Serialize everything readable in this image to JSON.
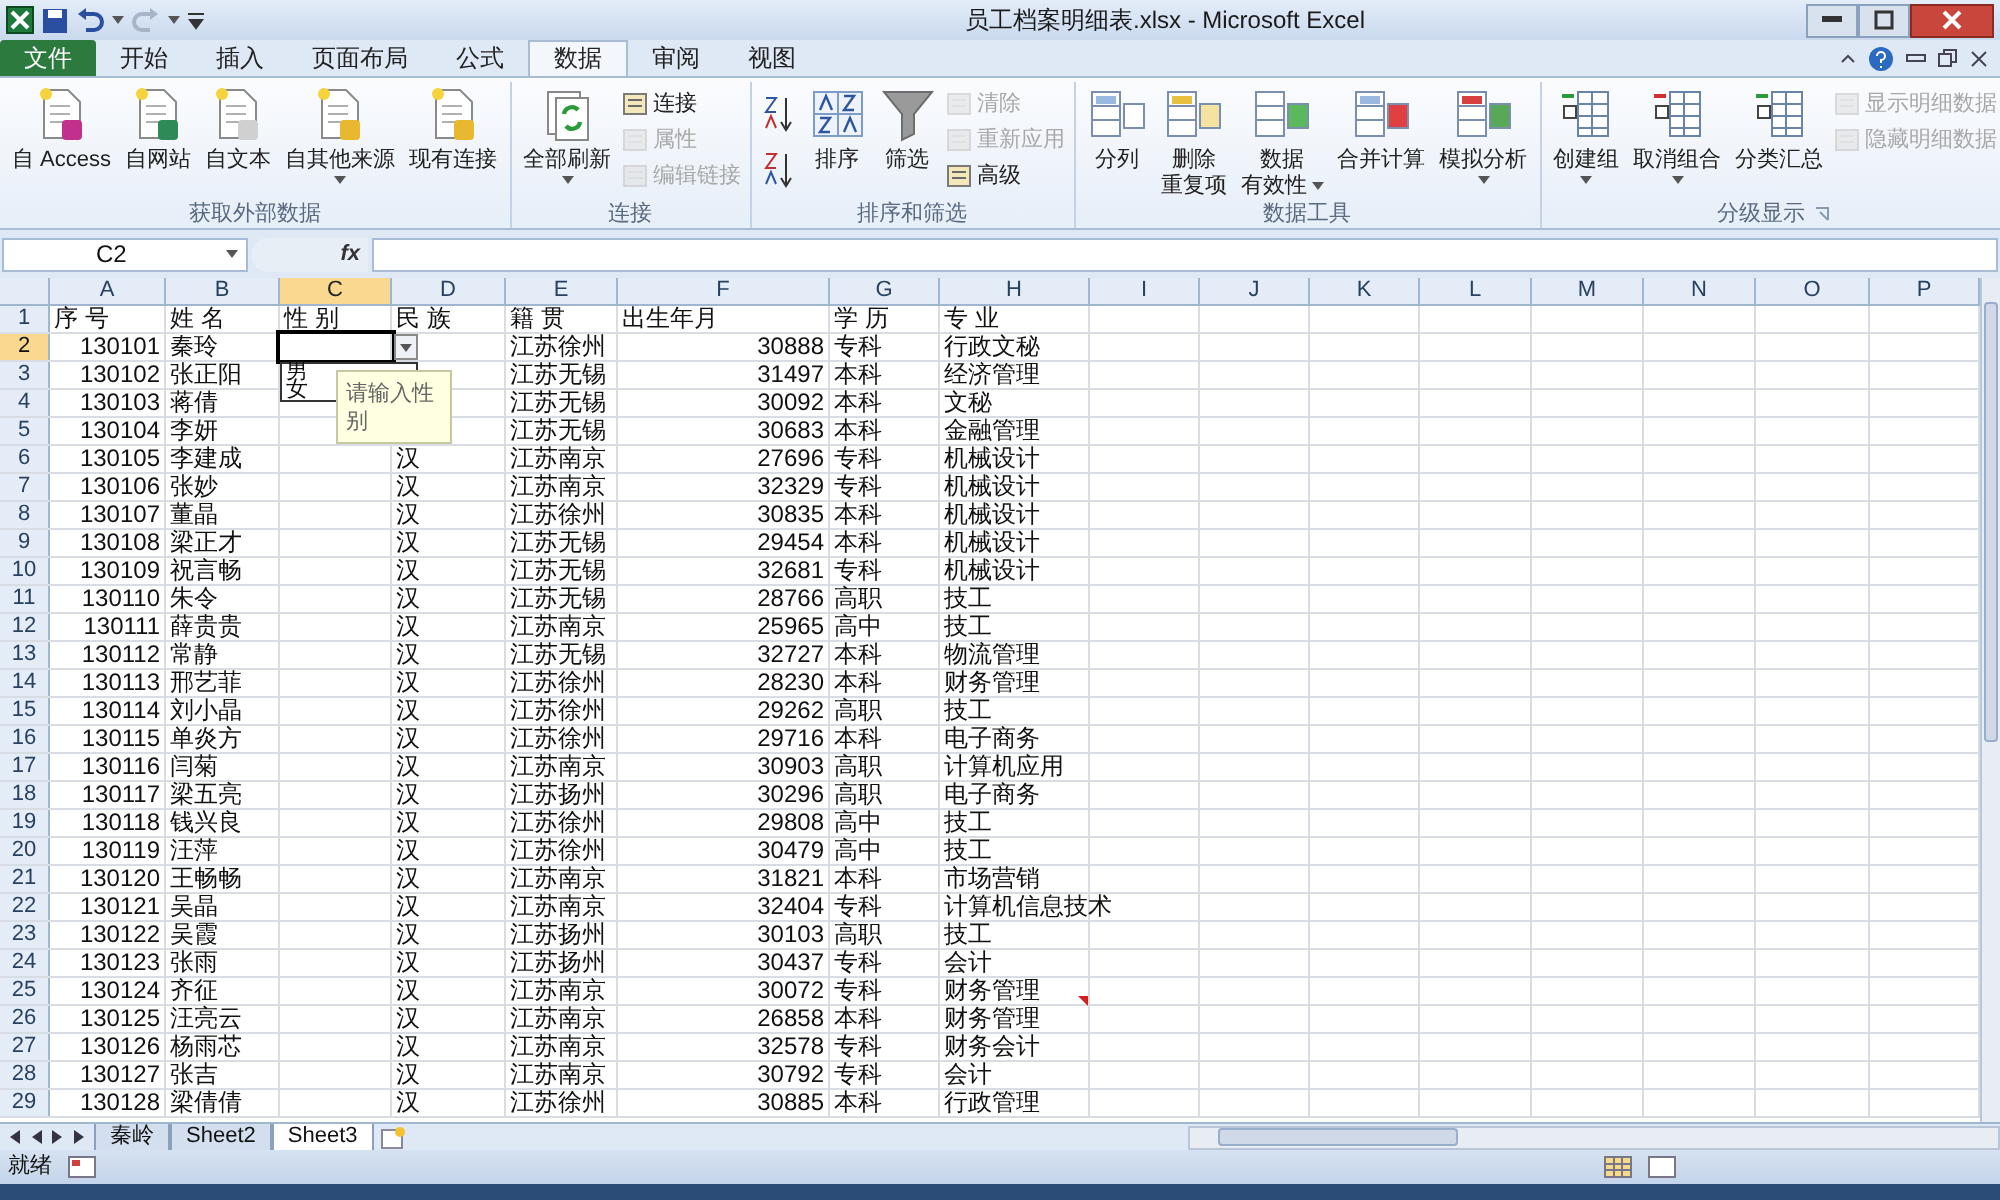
{
  "window": {
    "title": "员工档案明细表.xlsx - Microsoft Excel"
  },
  "ribbon_tabs": [
    {
      "label": "文件",
      "kind": "file",
      "selected": false
    },
    {
      "label": "开始",
      "kind": "tab",
      "selected": false
    },
    {
      "label": "插入",
      "kind": "tab",
      "selected": false
    },
    {
      "label": "页面布局",
      "kind": "tab",
      "selected": false
    },
    {
      "label": "公式",
      "kind": "tab",
      "selected": false
    },
    {
      "label": "数据",
      "kind": "tab",
      "selected": true
    },
    {
      "label": "审阅",
      "kind": "tab",
      "selected": false
    },
    {
      "label": "视图",
      "kind": "tab",
      "selected": false
    }
  ],
  "ribbon_groups": [
    {
      "label": "获取外部数据",
      "items": [
        {
          "kind": "large",
          "lines": [
            "自 Access"
          ],
          "dropdown": false
        },
        {
          "kind": "large",
          "lines": [
            "自网站"
          ],
          "dropdown": false
        },
        {
          "kind": "large",
          "lines": [
            "自文本"
          ],
          "dropdown": false
        },
        {
          "kind": "large",
          "lines": [
            "自其他来源"
          ],
          "dropdown": true
        },
        {
          "kind": "large",
          "lines": [
            "现有连接"
          ],
          "dropdown": false
        }
      ]
    },
    {
      "label": "连接",
      "items": [
        {
          "kind": "large",
          "lines": [
            "全部刷新"
          ],
          "dropdown": true
        },
        {
          "kind": "small",
          "label": "连接",
          "disabled": false
        },
        {
          "kind": "small",
          "label": "属性",
          "disabled": true
        },
        {
          "kind": "small",
          "label": "编辑链接",
          "disabled": true
        }
      ]
    },
    {
      "label": "排序和筛选",
      "items": [
        {
          "kind": "sortpair"
        },
        {
          "kind": "large",
          "lines": [
            "排序"
          ],
          "dropdown": false
        },
        {
          "kind": "large",
          "lines": [
            "筛选"
          ],
          "dropdown": false
        },
        {
          "kind": "small",
          "label": "清除",
          "disabled": true
        },
        {
          "kind": "small",
          "label": "重新应用",
          "disabled": true
        },
        {
          "kind": "small",
          "label": "高级",
          "disabled": false
        }
      ]
    },
    {
      "label": "数据工具",
      "items": [
        {
          "kind": "large",
          "lines": [
            "分列"
          ],
          "dropdown": false
        },
        {
          "kind": "large",
          "lines": [
            "删除",
            "重复项"
          ],
          "dropdown": false
        },
        {
          "kind": "large",
          "lines": [
            "数据",
            "有效性"
          ],
          "dropdown": true
        },
        {
          "kind": "large",
          "lines": [
            "合并计算"
          ],
          "dropdown": false
        },
        {
          "kind": "large",
          "lines": [
            "模拟分析"
          ],
          "dropdown": true
        }
      ]
    },
    {
      "label": "分级显示",
      "items": [
        {
          "kind": "large",
          "lines": [
            "创建组"
          ],
          "dropdown": true
        },
        {
          "kind": "large",
          "lines": [
            "取消组合"
          ],
          "dropdown": true
        },
        {
          "kind": "large",
          "lines": [
            "分类汇总"
          ],
          "dropdown": false
        },
        {
          "kind": "small",
          "label": "显示明细数据",
          "disabled": true
        },
        {
          "kind": "small",
          "label": "隐藏明细数据",
          "disabled": true
        }
      ]
    }
  ],
  "name_box": "C2",
  "formula_bar": {
    "fx": "fx"
  },
  "columns": [
    {
      "label": "A",
      "selected": false
    },
    {
      "label": "B",
      "selected": false
    },
    {
      "label": "C",
      "selected": true
    },
    {
      "label": "D",
      "selected": false
    },
    {
      "label": "E",
      "selected": false
    },
    {
      "label": "F",
      "selected": false
    },
    {
      "label": "G",
      "selected": false
    },
    {
      "label": "H",
      "selected": false
    },
    {
      "label": "I",
      "selected": false
    },
    {
      "label": "J",
      "selected": false
    },
    {
      "label": "K",
      "selected": false
    },
    {
      "label": "L",
      "selected": false
    },
    {
      "label": "M",
      "selected": false
    },
    {
      "label": "N",
      "selected": false
    },
    {
      "label": "O",
      "selected": false
    },
    {
      "label": "P",
      "selected": false
    }
  ],
  "rows": [
    {
      "number": "1",
      "selected": false,
      "comment": false,
      "cells": [
        "序 号",
        "姓 名",
        "性 别",
        "民 族",
        "籍 贯",
        "出生年月",
        "学 历",
        "专 业"
      ]
    },
    {
      "number": "2",
      "selected": true,
      "comment": false,
      "cells": [
        "130101",
        "秦玲",
        null,
        null,
        "江苏徐州",
        "30888",
        "专科",
        "行政文秘"
      ]
    },
    {
      "number": "3",
      "selected": false,
      "comment": false,
      "cells": [
        "130102",
        "张正阳",
        null,
        null,
        "江苏无锡",
        "31497",
        "本科",
        "经济管理"
      ]
    },
    {
      "number": "4",
      "selected": false,
      "comment": false,
      "cells": [
        "130103",
        "蒋倩",
        null,
        null,
        "江苏无锡",
        "30092",
        "本科",
        "文秘"
      ]
    },
    {
      "number": "5",
      "selected": false,
      "comment": false,
      "cells": [
        "130104",
        "李妍",
        null,
        null,
        "江苏无锡",
        "30683",
        "本科",
        "金融管理"
      ]
    },
    {
      "number": "6",
      "selected": false,
      "comment": false,
      "cells": [
        "130105",
        "李建成",
        null,
        "汉",
        "江苏南京",
        "27696",
        "专科",
        "机械设计"
      ]
    },
    {
      "number": "7",
      "selected": false,
      "comment": false,
      "cells": [
        "130106",
        "张妙",
        null,
        "汉",
        "江苏南京",
        "32329",
        "专科",
        "机械设计"
      ]
    },
    {
      "number": "8",
      "selected": false,
      "comment": false,
      "cells": [
        "130107",
        "董晶",
        null,
        "汉",
        "江苏徐州",
        "30835",
        "本科",
        "机械设计"
      ]
    },
    {
      "number": "9",
      "selected": false,
      "comment": false,
      "cells": [
        "130108",
        "梁正才",
        null,
        "汉",
        "江苏无锡",
        "29454",
        "本科",
        "机械设计"
      ]
    },
    {
      "number": "10",
      "selected": false,
      "comment": false,
      "cells": [
        "130109",
        "祝言畅",
        null,
        "汉",
        "江苏无锡",
        "32681",
        "专科",
        "机械设计"
      ]
    },
    {
      "number": "11",
      "selected": false,
      "comment": false,
      "cells": [
        "130110",
        "朱令",
        null,
        "汉",
        "江苏无锡",
        "28766",
        "高职",
        "技工"
      ]
    },
    {
      "number": "12",
      "selected": false,
      "comment": false,
      "cells": [
        "130111",
        "薛贵贵",
        null,
        "汉",
        "江苏南京",
        "25965",
        "高中",
        "技工"
      ]
    },
    {
      "number": "13",
      "selected": false,
      "comment": false,
      "cells": [
        "130112",
        "常静",
        null,
        "汉",
        "江苏无锡",
        "32727",
        "本科",
        "物流管理"
      ]
    },
    {
      "number": "14",
      "selected": false,
      "comment": false,
      "cells": [
        "130113",
        "邢艺菲",
        null,
        "汉",
        "江苏徐州",
        "28230",
        "本科",
        "财务管理"
      ]
    },
    {
      "number": "15",
      "selected": false,
      "comment": false,
      "cells": [
        "130114",
        "刘小晶",
        null,
        "汉",
        "江苏徐州",
        "29262",
        "高职",
        "技工"
      ]
    },
    {
      "number": "16",
      "selected": false,
      "comment": false,
      "cells": [
        "130115",
        "单炎方",
        null,
        "汉",
        "江苏徐州",
        "29716",
        "本科",
        "电子商务"
      ]
    },
    {
      "number": "17",
      "selected": false,
      "comment": false,
      "cells": [
        "130116",
        "闫菊",
        null,
        "汉",
        "江苏南京",
        "30903",
        "高职",
        "计算机应用"
      ]
    },
    {
      "number": "18",
      "selected": false,
      "comment": false,
      "cells": [
        "130117",
        "梁五亮",
        null,
        "汉",
        "江苏扬州",
        "30296",
        "高职",
        "电子商务"
      ]
    },
    {
      "number": "19",
      "selected": false,
      "comment": false,
      "cells": [
        "130118",
        "钱兴良",
        null,
        "汉",
        "江苏徐州",
        "29808",
        "高中",
        "技工"
      ]
    },
    {
      "number": "20",
      "selected": false,
      "comment": false,
      "cells": [
        "130119",
        "汪萍",
        null,
        "汉",
        "江苏徐州",
        "30479",
        "高中",
        "技工"
      ]
    },
    {
      "number": "21",
      "selected": false,
      "comment": false,
      "cells": [
        "130120",
        "王畅畅",
        null,
        "汉",
        "江苏南京",
        "31821",
        "本科",
        "市场营销"
      ]
    },
    {
      "number": "22",
      "selected": false,
      "comment": false,
      "cells": [
        "130121",
        "吴晶",
        null,
        "汉",
        "江苏南京",
        "32404",
        "专科",
        "计算机信息技术"
      ]
    },
    {
      "number": "23",
      "selected": false,
      "comment": false,
      "cells": [
        "130122",
        "吴霞",
        null,
        "汉",
        "江苏扬州",
        "30103",
        "高职",
        "技工"
      ]
    },
    {
      "number": "24",
      "selected": false,
      "comment": false,
      "cells": [
        "130123",
        "张雨",
        null,
        "汉",
        "江苏扬州",
        "30437",
        "专科",
        "会计"
      ]
    },
    {
      "number": "25",
      "selected": false,
      "comment": true,
      "cells": [
        "130124",
        "齐征",
        null,
        "汉",
        "江苏南京",
        "30072",
        "专科",
        "财务管理"
      ]
    },
    {
      "number": "26",
      "selected": false,
      "comment": false,
      "cells": [
        "130125",
        "汪亮云",
        null,
        "汉",
        "江苏南京",
        "26858",
        "本科",
        "财务管理"
      ]
    },
    {
      "number": "27",
      "selected": false,
      "comment": false,
      "cells": [
        "130126",
        "杨雨芯",
        null,
        "汉",
        "江苏南京",
        "32578",
        "专科",
        "财务会计"
      ]
    },
    {
      "number": "28",
      "selected": false,
      "comment": false,
      "cells": [
        "130127",
        "张吉",
        null,
        "汉",
        "江苏南京",
        "30792",
        "专科",
        "会计"
      ]
    },
    {
      "number": "29",
      "selected": false,
      "comment": false,
      "cells": [
        "130128",
        "梁倩倩",
        null,
        "汉",
        "江苏徐州",
        "30885",
        "本科",
        "行政管理"
      ]
    }
  ],
  "dropdown_list": [
    "男",
    "女"
  ],
  "input_tooltip": "请输入性别",
  "sheet_tabs": [
    {
      "label": "秦岭",
      "selected": false
    },
    {
      "label": "Sheet2",
      "selected": false
    },
    {
      "label": "Sheet3",
      "selected": true
    }
  ],
  "status_bar": {
    "text": "就绪"
  }
}
